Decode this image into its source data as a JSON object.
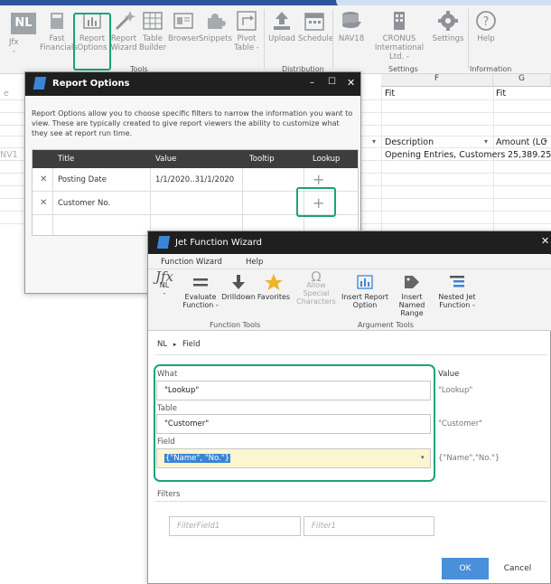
{
  "ribbon": {
    "buttons": [
      {
        "label": "Jfx",
        "sub": "-"
      },
      {
        "label": "Fast",
        "sub": "Financials"
      },
      {
        "label": "Report",
        "sub": "Options"
      },
      {
        "label": "Report",
        "sub": "Wizard"
      },
      {
        "label": "Table",
        "sub": "Builder"
      },
      {
        "label": "Browser",
        "sub": ""
      },
      {
        "label": "Snippets",
        "sub": ""
      },
      {
        "label": "Pivot",
        "sub": "Table -"
      },
      {
        "label": "Upload",
        "sub": ""
      },
      {
        "label": "Schedule",
        "sub": ""
      },
      {
        "label": "NAV18",
        "sub": ""
      },
      {
        "label": "CRONUS",
        "sub": "International Ltd. -"
      },
      {
        "label": "Settings",
        "sub": ""
      },
      {
        "label": "Help",
        "sub": ""
      }
    ],
    "nl_badge": "NL",
    "groups": {
      "tools": "Tools",
      "distribution": "Distribution",
      "settings": "Settings",
      "information": "Information"
    }
  },
  "sheet": {
    "col_f": "F",
    "col_g": "G",
    "row_labels": {
      "fit1": "Fit",
      "fit2": "Fit"
    },
    "left_fragment_1": "e",
    "left_fragment_2": "NV1",
    "headers": {
      "description": "Description",
      "amount": "Amount (LC"
    },
    "row1": {
      "description": "Opening Entries, Customers",
      "amount": "25,389.25"
    }
  },
  "report_options": {
    "title": "Report Options",
    "controls": {
      "minimize": "–",
      "maximize": "☐",
      "close": "✕"
    },
    "description": "Report Options allow you to choose specific filters to narrow the information you want to view. These are typically created to give report viewers the ability to customize what they see at report run time.",
    "columns": {
      "title": "Title",
      "value": "Value",
      "tooltip": "Tooltip",
      "lookup": "Lookup"
    },
    "rows": [
      {
        "delete": "✕",
        "title": "Posting Date",
        "value": "1/1/2020..31/1/2020",
        "tooltip": "",
        "lookup": "+"
      },
      {
        "delete": "✕",
        "title": "Customer No.",
        "value": "",
        "tooltip": "",
        "lookup": "+"
      }
    ]
  },
  "wizard": {
    "title": "Jet Function Wizard",
    "close": "✕",
    "tabs": {
      "function_wizard": "Function Wizard",
      "help": "Help"
    },
    "tools": [
      {
        "label": "NL",
        "sub": "-"
      },
      {
        "label": "Evaluate",
        "sub": "Function -"
      },
      {
        "label": "Drilldown",
        "sub": ""
      },
      {
        "label": "Favorites",
        "sub": ""
      },
      {
        "label": "Allow Special",
        "sub": "Characters"
      },
      {
        "label": "Insert Report",
        "sub": "Option"
      },
      {
        "label": "Insert Named",
        "sub": "Range"
      },
      {
        "label": "Nested Jet",
        "sub": "Function -"
      }
    ],
    "groups": {
      "function_tools": "Function Tools",
      "argument_tools": "Argument Tools"
    },
    "breadcrumb": {
      "root": "NL",
      "sep": "▸",
      "current": "Field"
    },
    "value_header": "Value",
    "fields": {
      "what": {
        "label": "What",
        "input": "\"Lookup\"",
        "value": "\"Lookup\""
      },
      "table": {
        "label": "Table",
        "input": "\"Customer\"",
        "value": "\"Customer\""
      },
      "field": {
        "label": "Field",
        "input": "{\"Name\", \"No.\"}",
        "value": "{\"Name\",\"No.\"}"
      }
    },
    "filters": {
      "label": "Filters",
      "filter_field_placeholder": "FilterField1",
      "filter_placeholder": "Filter1"
    },
    "buttons": {
      "ok": "OK",
      "cancel": "Cancel"
    }
  },
  "colors": {
    "accent": "#1aa37a",
    "titlebar": "#1f1f1f",
    "ok_button": "#4a90d9",
    "field_highlight": "#fbf6d0"
  }
}
